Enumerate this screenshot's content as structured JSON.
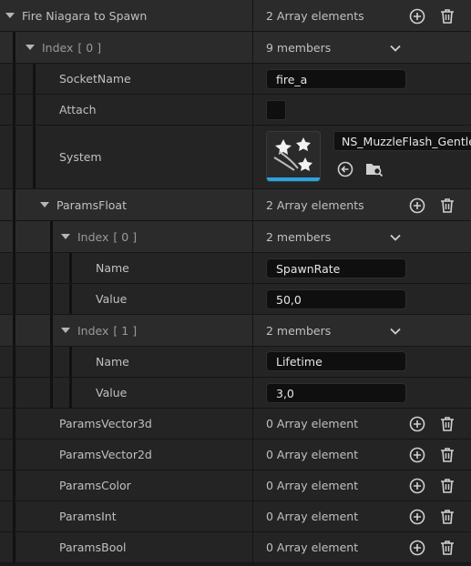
{
  "rows": {
    "root": {
      "label": "Fire Niagara to Spawn",
      "value": "2 Array elements"
    },
    "index0": {
      "label": "Index",
      "bracket": "[ 0 ]",
      "value": "9 members"
    },
    "socket": {
      "label": "SocketName",
      "value": "fire_a"
    },
    "attach": {
      "label": "Attach"
    },
    "system": {
      "label": "System",
      "asset": "NS_MuzzleFlash_Gentle"
    },
    "paramsFloat": {
      "label": "ParamsFloat",
      "value": "2 Array elements"
    },
    "pf0": {
      "label": "Index",
      "bracket": "[ 0 ]",
      "value": "2 members"
    },
    "pf0name": {
      "label": "Name",
      "value": "SpawnRate"
    },
    "pf0value": {
      "label": "Value",
      "value": "50,0"
    },
    "pf1": {
      "label": "Index",
      "bracket": "[ 1 ]",
      "value": "2 members"
    },
    "pf1name": {
      "label": "Name",
      "value": "Lifetime"
    },
    "pf1value": {
      "label": "Value",
      "value": "3,0"
    },
    "vec3": {
      "label": "ParamsVector3d",
      "value": "0 Array element"
    },
    "vec2": {
      "label": "ParamsVector2d",
      "value": "0 Array element"
    },
    "color": {
      "label": "ParamsColor",
      "value": "0 Array element"
    },
    "int": {
      "label": "ParamsInt",
      "value": "0 Array element"
    },
    "bool": {
      "label": "ParamsBool",
      "value": "0 Array element"
    }
  },
  "colors": {
    "accent": "#2aa3e0",
    "panel": "#242424",
    "header": "#2b2b2b"
  },
  "icons": [
    "expand-triangle-icon",
    "add-element-icon",
    "delete-icon",
    "chevron-down-icon",
    "niagara-stars-icon",
    "use-selected-icon",
    "browse-asset-icon"
  ]
}
